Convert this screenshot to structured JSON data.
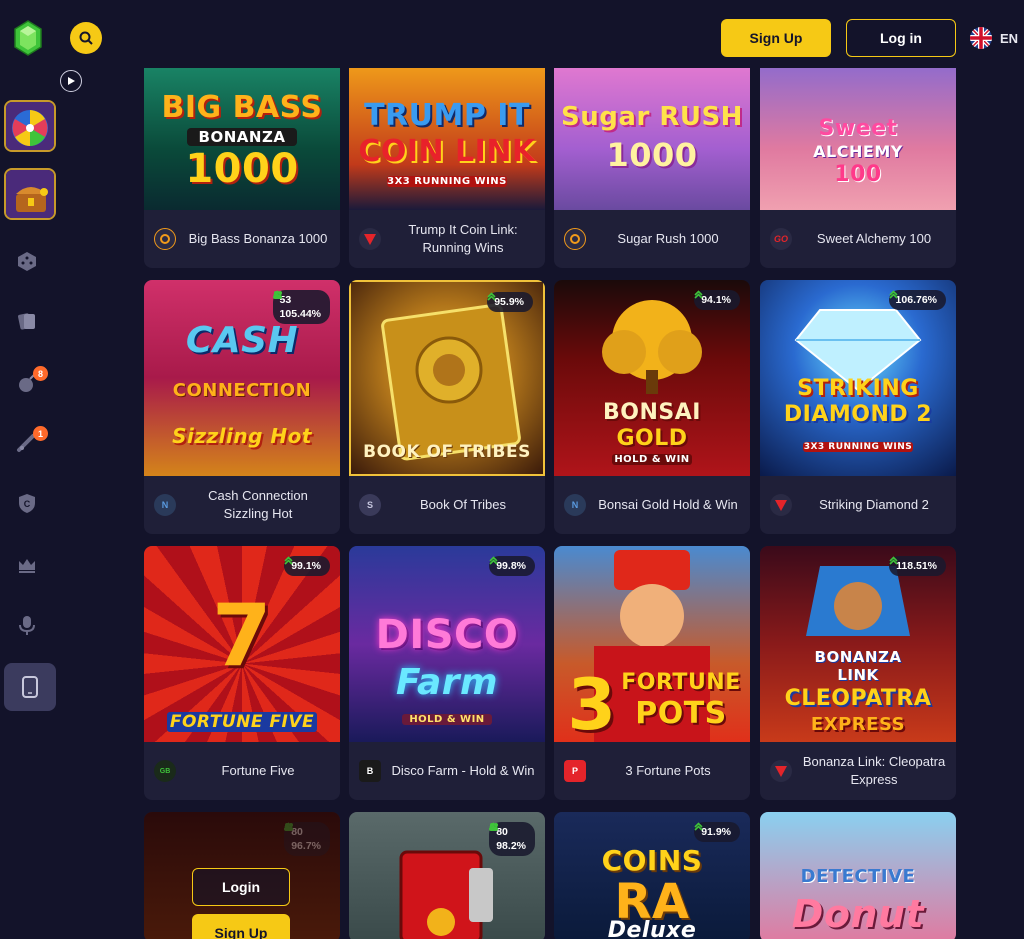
{
  "header": {
    "signup_label": "Sign Up",
    "login_label": "Log in",
    "lang": "EN"
  },
  "sidebar": {
    "badges": {
      "bombs": "8",
      "sports": "1"
    }
  },
  "games": [
    {
      "name": "Big Bass Bonanza 1000",
      "art": [
        "BIG BASS",
        "BONANZA",
        "1000"
      ],
      "provider_icon": "pragmatic-play-icon"
    },
    {
      "name": "Trump It Coin Link: Running Wins",
      "art": [
        "TRUMP IT",
        "COIN LINK",
        "3X3 RUNNING WINS"
      ],
      "provider_icon": "provider-red-icon"
    },
    {
      "name": "Sugar Rush 1000",
      "art": [
        "Sugar RUSH",
        "1000"
      ],
      "provider_icon": "pragmatic-play-icon"
    },
    {
      "name": "Sweet Alchemy 100",
      "art": [
        "Sweet",
        "ALCHEMY",
        "100"
      ],
      "provider_icon": "go-icon",
      "provider_text": "GO"
    },
    {
      "name": "Cash Connection Sizzling Hot",
      "art": [
        "CASH",
        "CONNECTION",
        "Sizzling Hot"
      ],
      "provider_icon": "provider-n-icon",
      "rtp_players": "53",
      "rtp": "105.44%"
    },
    {
      "name": "Book Of Tribes",
      "art": [
        "BOOK OF TRIBES"
      ],
      "provider_icon": "provider-s-icon",
      "rtp": "95.9%"
    },
    {
      "name": "Bonsai Gold Hold & Win",
      "art": [
        "BONSAI",
        "GOLD",
        "HOLD & WIN"
      ],
      "provider_icon": "provider-n-icon",
      "rtp": "94.1%"
    },
    {
      "name": "Striking Diamond 2",
      "art": [
        "STRIKING",
        "DIAMOND 2",
        "3X3 RUNNING WINS"
      ],
      "provider_icon": "provider-red-icon",
      "rtp": "106.76%"
    },
    {
      "name": "Fortune Five",
      "art": [
        "7",
        "FORTUNE FIVE"
      ],
      "provider_icon": "gamebeat-icon",
      "rtp": "99.1%"
    },
    {
      "name": "Disco Farm - Hold & Win",
      "art": [
        "DISCO",
        "Farm",
        "HOLD & WIN"
      ],
      "provider_icon": "provider-b-icon",
      "rtp": "99.8%"
    },
    {
      "name": "3 Fortune Pots",
      "art": [
        "3",
        "FORTUNE",
        "POTS"
      ],
      "provider_icon": "provider-p-icon",
      "provider_text": "P"
    },
    {
      "name": "Bonanza Link: Cleopatra Express",
      "art": [
        "BONANZA",
        "LINK",
        "CLEOPATRA",
        "EXPRESS"
      ],
      "provider_icon": "provider-red-icon",
      "rtp": "118.51%"
    },
    {
      "name": "",
      "rtp_players": "80",
      "rtp": "96.7%"
    },
    {
      "name": "",
      "rtp_players": "80",
      "rtp": "98.2%"
    },
    {
      "name": "",
      "art": [
        "COINS",
        "RA",
        "Deluxe"
      ],
      "rtp": "91.9%"
    },
    {
      "name": "",
      "art": [
        "DETECTIVE",
        "Donut"
      ]
    }
  ],
  "overlay": {
    "login_label": "Login",
    "signup_label": "Sign Up"
  }
}
